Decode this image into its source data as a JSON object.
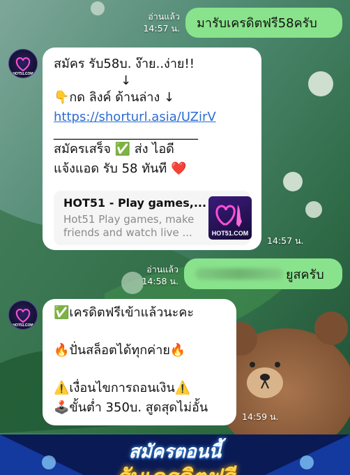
{
  "messages": [
    {
      "direction": "outgoing",
      "read": "อ่านแล้ว",
      "time": "14:57 น.",
      "text": "มารับเครดิตฟรี58ครับ"
    },
    {
      "direction": "incoming",
      "time": "14:57 น.",
      "lines": [
        "สมัคร รับ58บ. ง๊าย..ง่าย!!",
        "↓",
        "👇กด ลิงค์ ด้านล่าง ↓",
        "https://shorturl.asia/UZirV",
        "_______________________",
        "สมัครเสร็จ ✅ ส่ง ไอดี",
        "แจ้งแอด รับ 58 ทันที ❤️"
      ],
      "link_preview": {
        "title": "HOT51 - Play games,...",
        "description_line1": "Hot51 Play games, make",
        "description_line2": "friends and watch live ...",
        "thumb_label": "HOT51.COM"
      }
    },
    {
      "direction": "outgoing",
      "read": "อ่านแล้ว",
      "time": "14:58 น.",
      "text_visible": "ยูสครับ"
    },
    {
      "direction": "incoming",
      "time": "14:59 น.",
      "lines": [
        "✅เครดิตฟรีเข้าแล้วนะคะ",
        "",
        "🔥ปั่นสล็อตได้ทุกค่าย🔥",
        "",
        "⚠️เงื่อนไขการถอนเงิน⚠️",
        "🕹️ขั้นต่ำ 350บ. สูดสุดไม่อั้น"
      ]
    }
  ],
  "avatar_label": "HOT51.COM",
  "banner": {
    "line1": "สมัครตอนนี้",
    "line2": "รับเครดิตฟรี"
  },
  "colors": {
    "outgoing_bubble": "#89e38c",
    "incoming_bubble": "#ffffff",
    "link": "#2b6cd3"
  }
}
